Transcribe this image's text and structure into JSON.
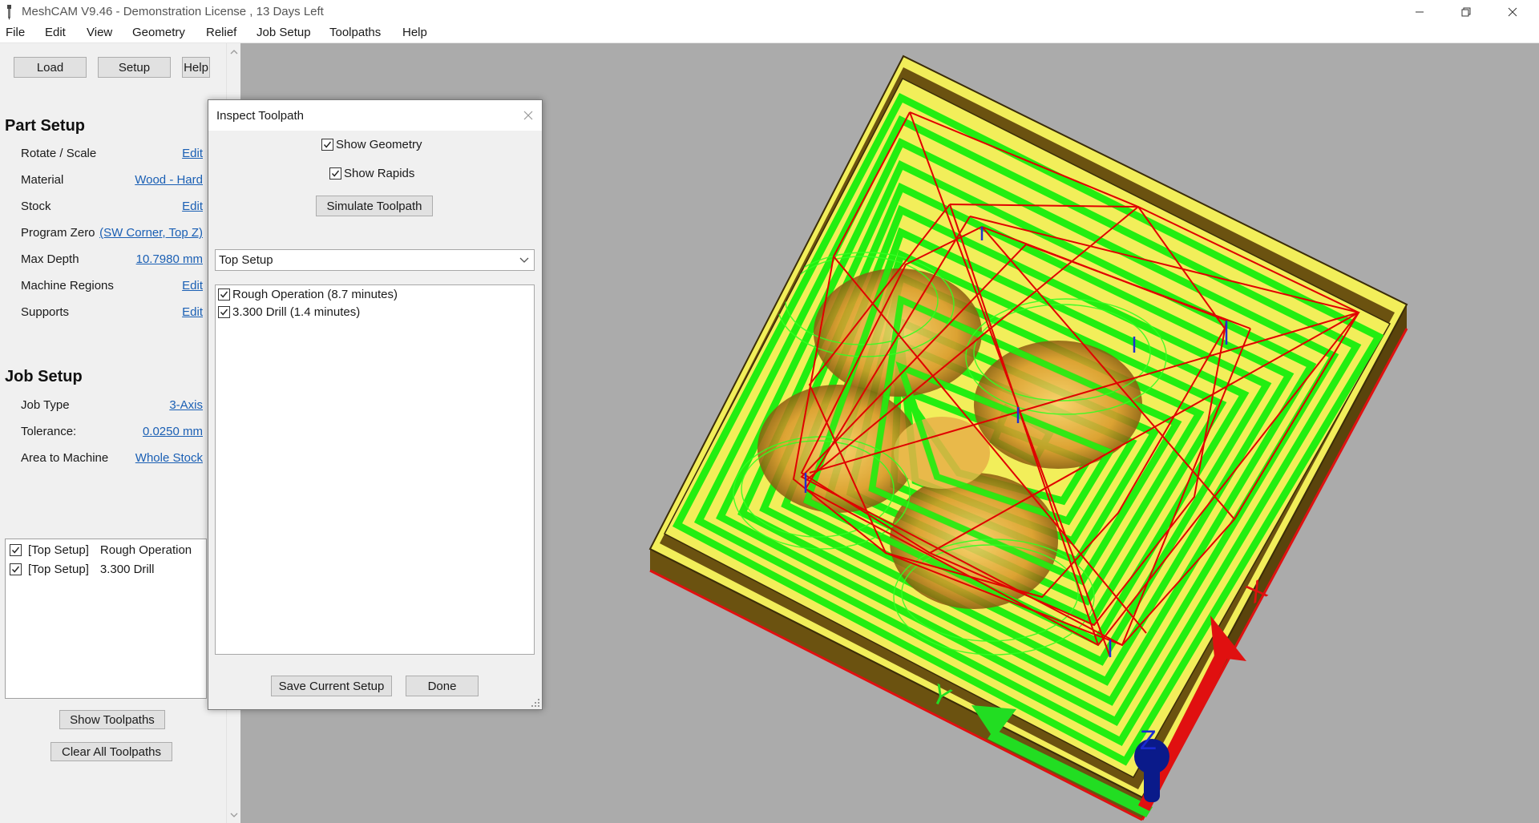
{
  "window": {
    "title": "MeshCAM V9.46 - Demonstration License  , 13 Days Left"
  },
  "menu": [
    "File",
    "Edit",
    "View",
    "Geometry",
    "Relief",
    "Job Setup",
    "Toolpaths",
    "Help"
  ],
  "toolbar": {
    "load_label": "Load",
    "setup_label": "Setup",
    "help_label": "Help"
  },
  "part_setup": {
    "title": "Part Setup",
    "rows": [
      {
        "label": "Rotate / Scale",
        "value": "Edit"
      },
      {
        "label": "Material",
        "value": "Wood - Hard"
      },
      {
        "label": "Stock",
        "value": "Edit"
      },
      {
        "label": "Program Zero",
        "value": "(SW Corner, Top Z)"
      },
      {
        "label": "Max Depth",
        "value": "10.7980 mm"
      },
      {
        "label": "Machine Regions",
        "value": "Edit"
      },
      {
        "label": "Supports",
        "value": "Edit"
      }
    ]
  },
  "job_setup": {
    "title": "Job Setup",
    "rows": [
      {
        "label": "Job Type",
        "value": "3-Axis"
      },
      {
        "label": "Tolerance:",
        "value": "0.0250 mm"
      },
      {
        "label": "Area to Machine",
        "value": "Whole Stock"
      }
    ]
  },
  "operations": [
    {
      "tag": "[Top Setup]",
      "name": "Rough Operation",
      "checked": true
    },
    {
      "tag": "[Top Setup]",
      "name": "3.300 Drill",
      "checked": true
    }
  ],
  "panel_buttons": {
    "show_toolpaths": "Show Toolpaths",
    "clear_toolpaths": "Clear All Toolpaths"
  },
  "dialog": {
    "title": "Inspect Toolpath",
    "show_geometry": "Show Geometry",
    "show_rapids": "Show Rapids",
    "simulate": "Simulate Toolpath",
    "setup_select": "Top Setup",
    "toolpaths": [
      {
        "label": "Rough Operation (8.7 minutes)",
        "checked": true
      },
      {
        "label": "3.300 Drill (1.4 minutes)",
        "checked": true
      }
    ],
    "save_button": "Save Current Setup",
    "done_button": "Done"
  },
  "axes": {
    "x": "X",
    "y": "Y",
    "z": "Z"
  },
  "colors": {
    "viewport_bg": "#ababab",
    "stock_top": "#f2ee5a",
    "stock_side": "#6b5210",
    "toolpath": "#22ee11",
    "rapid": "#e00000",
    "x_axis": "#e01010",
    "y_axis": "#22dd22",
    "z_axis": "#0a1a8a"
  }
}
